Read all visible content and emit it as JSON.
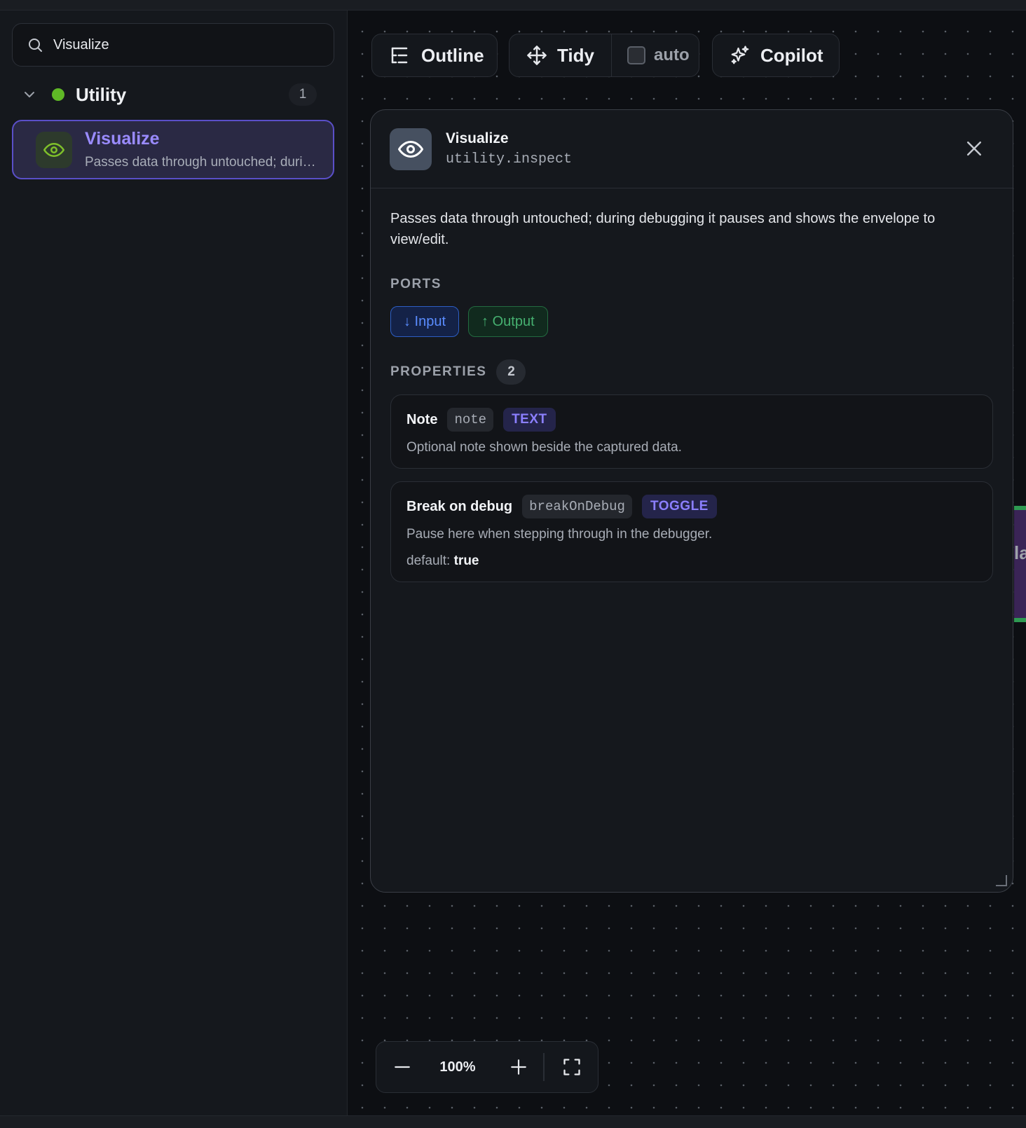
{
  "sidebar": {
    "search": {
      "value": "Visualize",
      "placeholder": ""
    },
    "group": {
      "name": "Utility",
      "count": "1",
      "dot_color": "#5fb826"
    },
    "item": {
      "title": "Visualize",
      "desc": "Passes data through untouched; during debugging it pauses and shows the envelope to view/edit."
    }
  },
  "toolbar": {
    "outline_label": "Outline",
    "tidy_label": "Tidy",
    "auto_label": "auto",
    "auto_checked": false,
    "copilot_label": "Copilot"
  },
  "panel": {
    "title": "Visualize",
    "slug": "utility.inspect",
    "description": "Passes data through untouched; during debugging it pauses and shows the envelope to view/edit.",
    "ports_heading": "PORTS",
    "ports": {
      "input": "↓ Input",
      "output": "↑ Output"
    },
    "properties_heading": "PROPERTIES",
    "properties_count": "2",
    "properties": [
      {
        "name": "Note",
        "key": "note",
        "type": "TEXT",
        "desc": "Optional note shown beside the captured data."
      },
      {
        "name": "Break on debug",
        "key": "breakOnDebug",
        "type": "TOGGLE",
        "desc": "Pause here when stepping through in the debugger.",
        "default_label": "default:",
        "default_value": "true"
      }
    ]
  },
  "zoom": {
    "level": "100%"
  },
  "peek_node": {
    "text": "la"
  },
  "colors": {
    "accent": "#9a8bff",
    "input": "#5a8cff",
    "output": "#46b070",
    "category": "#5fb826"
  }
}
